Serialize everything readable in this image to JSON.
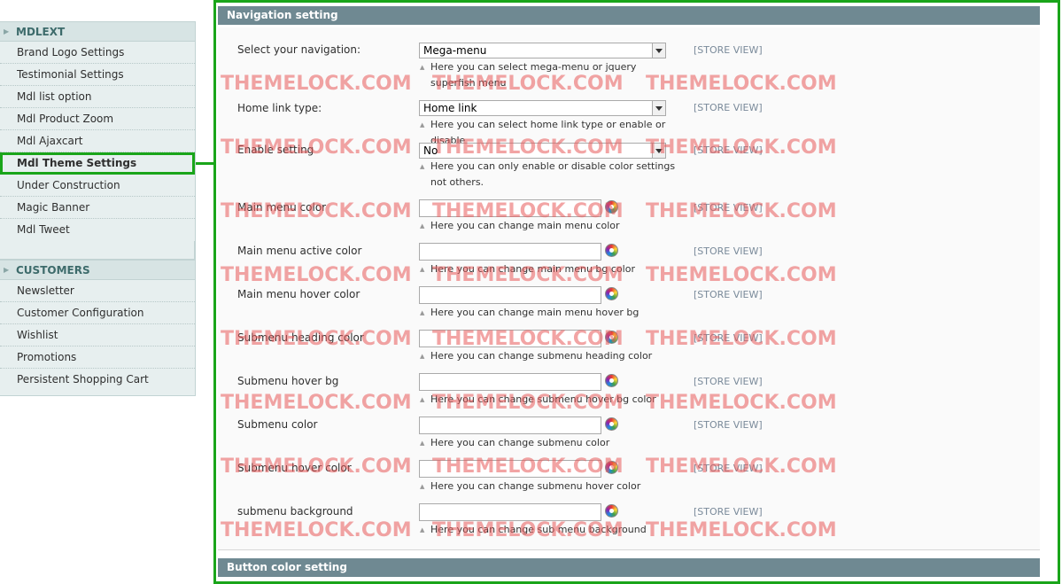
{
  "sidebar": {
    "sections": [
      {
        "title": "MDLEXT",
        "items": [
          "Brand Logo Settings",
          "Testimonial Settings",
          "Mdl list option",
          "Mdl Product Zoom",
          "Mdl Ajaxcart",
          "Mdl Theme Settings",
          "Under Construction",
          "Magic Banner",
          "Mdl Tweet"
        ],
        "active_index": 5
      },
      {
        "title": "CUSTOMERS",
        "items": [
          "Newsletter",
          "Customer Configuration",
          "Wishlist",
          "Promotions",
          "Persistent Shopping Cart"
        ]
      }
    ]
  },
  "main": {
    "section_title": "Navigation setting",
    "next_section_title": "Button color setting",
    "scope_label": "[STORE VIEW]",
    "fields": [
      {
        "label": "Select your navigation:",
        "type": "select",
        "value": "Mega-menu",
        "note": "Here you can select mega-menu or jquery superfish menu"
      },
      {
        "label": "Home link type:",
        "type": "select",
        "value": "Home link",
        "note": "Here you can select home link type or enable or disable"
      },
      {
        "label": "Enable setting",
        "type": "select",
        "value": "No",
        "note": "Here you can only enable or disable color settings not others."
      },
      {
        "label": "Main menu color",
        "type": "color",
        "value": "",
        "note": "Here you can change main menu color"
      },
      {
        "label": "Main menu active color",
        "type": "color",
        "value": "",
        "note": "Here you can change main menu bg color"
      },
      {
        "label": "Main menu hover color",
        "type": "color",
        "value": "",
        "note": "Here you can change main menu hover bg"
      },
      {
        "label": "Submenu heading color",
        "type": "color",
        "value": "",
        "note": "Here you can change submenu heading color"
      },
      {
        "label": "Submenu hover bg",
        "type": "color",
        "value": "",
        "note": "Here you can change submenu hover bg color"
      },
      {
        "label": "Submenu color",
        "type": "color",
        "value": "",
        "note": "Here you can change submenu color"
      },
      {
        "label": "Submenu hover color",
        "type": "color",
        "value": "",
        "note": "Here you can change submenu hover color"
      },
      {
        "label": "submenu background",
        "type": "color",
        "value": "",
        "note": "Here you can change sub menu background"
      }
    ]
  },
  "watermark": "THEMELOCK.COM",
  "colors": {
    "highlight": "#1aa51a",
    "section_header": "#6f8992",
    "sidebar_bg": "#e7efef",
    "watermark": "#e85a5a"
  }
}
